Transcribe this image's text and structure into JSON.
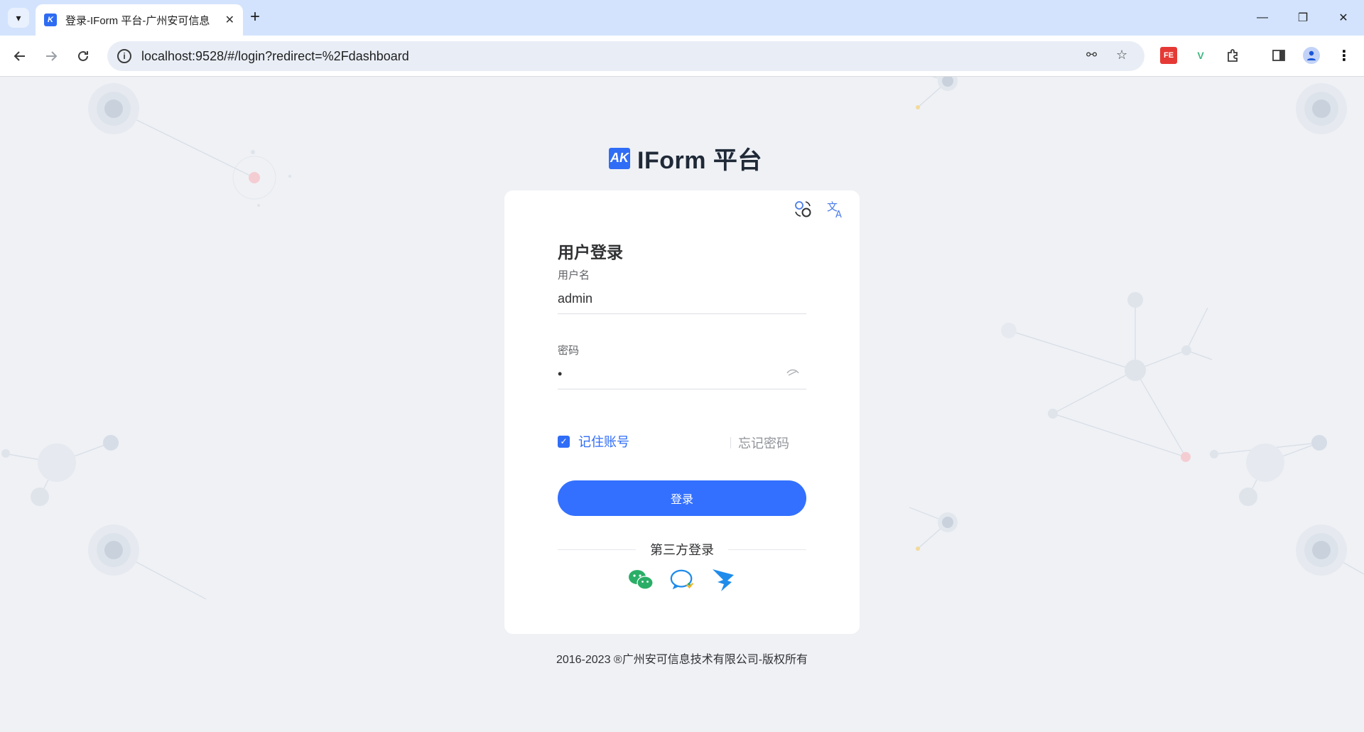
{
  "browser": {
    "tab_title": "登录-IForm 平台-广州安可信息",
    "url": "localhost:9528/#/login?redirect=%2Fdashboard"
  },
  "brand": {
    "logo_text": "AK",
    "name": "IForm 平台"
  },
  "login": {
    "title": "用户登录",
    "username_label": "用户名",
    "username_value": "admin",
    "password_label": "密码",
    "password_value": "•",
    "remember_label": "记住账号",
    "remember_checked": true,
    "forgot_label": "忘记密码",
    "submit_label": "登录",
    "third_party_label": "第三方登录"
  },
  "footer": {
    "copyright": "2016-2023 ®广州安可信息技术有限公司-版权所有"
  },
  "colors": {
    "accent": "#3370ff",
    "background": "#eff1f5",
    "wechat": "#2aae67",
    "dingtalk": "#1f8ceb"
  }
}
